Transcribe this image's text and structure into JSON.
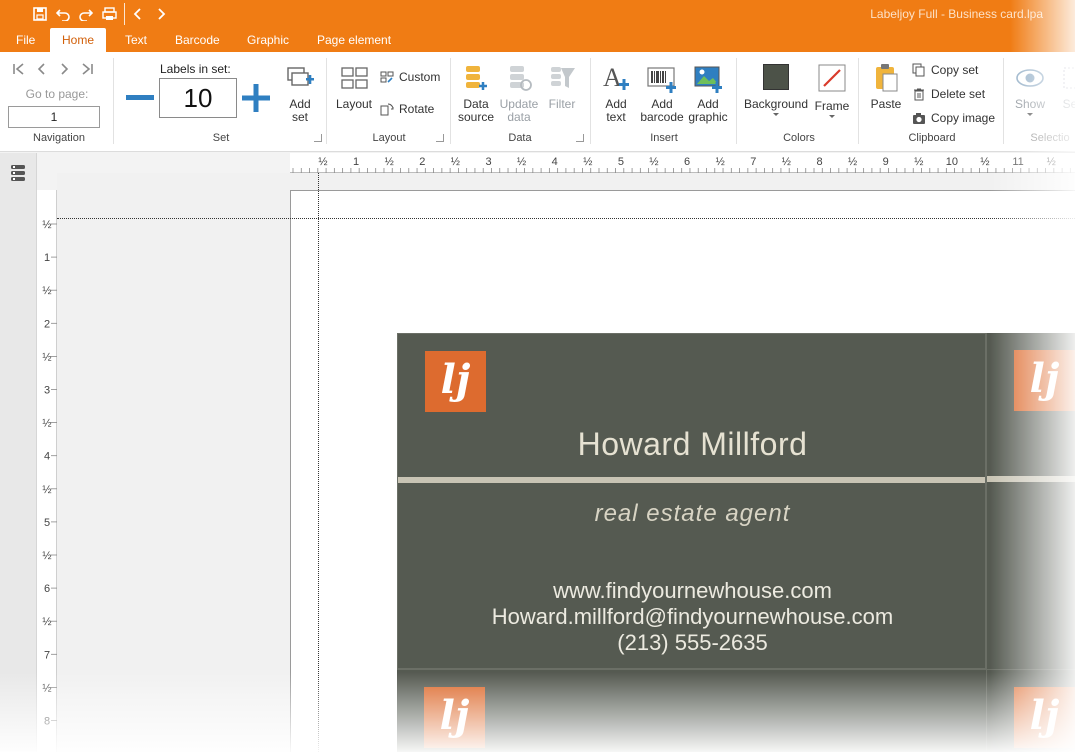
{
  "app": {
    "title": "Labeljoy Full - Business card.lpa"
  },
  "quick_access": [
    "save-icon",
    "undo-icon",
    "redo-icon",
    "print-icon",
    "back-icon",
    "forward-icon"
  ],
  "tabs": [
    "File",
    "Home",
    "Text",
    "Barcode",
    "Graphic",
    "Page element"
  ],
  "active_tab": "Home",
  "ribbon": {
    "navigation": {
      "go_to_page_label": "Go to page:",
      "page_value": "1",
      "group": "Navigation"
    },
    "set": {
      "labels_in_set_label": "Labels in set:",
      "count": "10",
      "add_set": "Add\nset",
      "group": "Set"
    },
    "layout": {
      "layout": "Layout",
      "custom": "Custom",
      "rotate": "Rotate",
      "group": "Layout"
    },
    "data": {
      "data_source": "Data\nsource",
      "update_data": "Update\ndata",
      "filter": "Filter",
      "group": "Data"
    },
    "insert": {
      "add_text": "Add\ntext",
      "add_barcode": "Add\nbarcode",
      "add_graphic": "Add\ngraphic",
      "group": "Insert"
    },
    "colors": {
      "background": "Background",
      "frame": "Frame",
      "group": "Colors",
      "background_color": "#4c5248",
      "frame_color": "#d93a2b"
    },
    "clipboard": {
      "paste": "Paste",
      "copy_set": "Copy set",
      "delete_set": "Delete set",
      "copy_image": "Copy image",
      "group": "Clipboard"
    },
    "selection": {
      "show": "Show",
      "select": "Se",
      "group": "Selectio"
    }
  },
  "rulers": {
    "horizontal": [
      "½",
      "1",
      "½",
      "2",
      "½",
      "3",
      "½",
      "4",
      "½",
      "5",
      "½",
      "6",
      "½",
      "7",
      "½",
      "8",
      "½",
      "9",
      "½",
      "10",
      "½",
      "11",
      "½"
    ],
    "vertical": [
      "½",
      "1",
      "½",
      "2",
      "½",
      "3",
      "½",
      "4",
      "½",
      "5",
      "½",
      "6",
      "½",
      "7",
      "½",
      "8"
    ]
  },
  "card": {
    "logo_text": "lj",
    "name": "Howard Millford",
    "role": "real estate agent",
    "website": "www.findyournewhouse.com",
    "email": "Howard.millford@findyournewhouse.com",
    "phone": "(213) 555-2635",
    "bg_color": "#555a51",
    "logo_color": "#dd6b2f"
  }
}
